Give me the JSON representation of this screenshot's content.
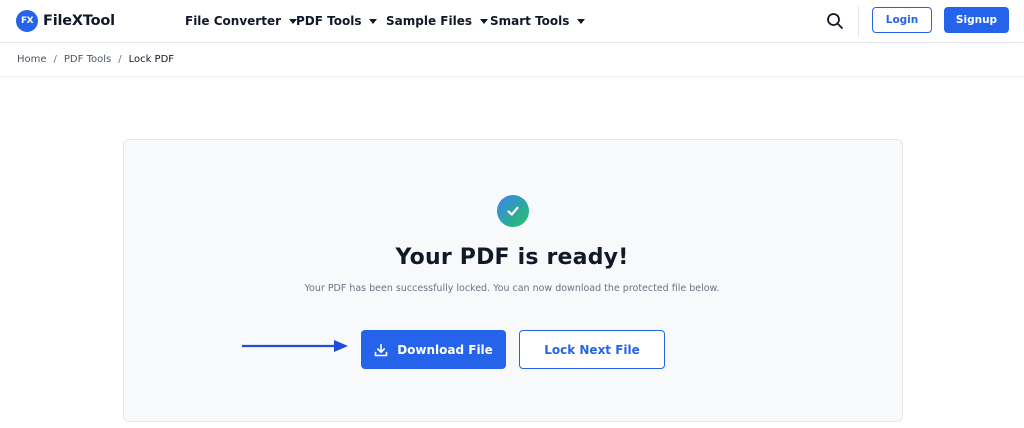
{
  "brand": {
    "badge": "FX",
    "name": "FileXTool",
    "accent": "#2563eb"
  },
  "nav": {
    "items": [
      {
        "label": "File Converter"
      },
      {
        "label": "PDF Tools"
      },
      {
        "label": "Sample Files"
      },
      {
        "label": "Smart Tools"
      }
    ],
    "search_icon": "search-icon",
    "login_label": "Login",
    "signup_label": "Signup"
  },
  "breadcrumb": {
    "items": [
      "Home",
      "PDF Tools"
    ],
    "separator": "/",
    "current": "Lock PDF"
  },
  "result": {
    "icon": "check-circle-icon",
    "title": "Your PDF is ready!",
    "message": "Your PDF has been successfully locked. You can now download the protected file below.",
    "download_label": "Download File",
    "lock_next_label": "Lock Next File"
  }
}
